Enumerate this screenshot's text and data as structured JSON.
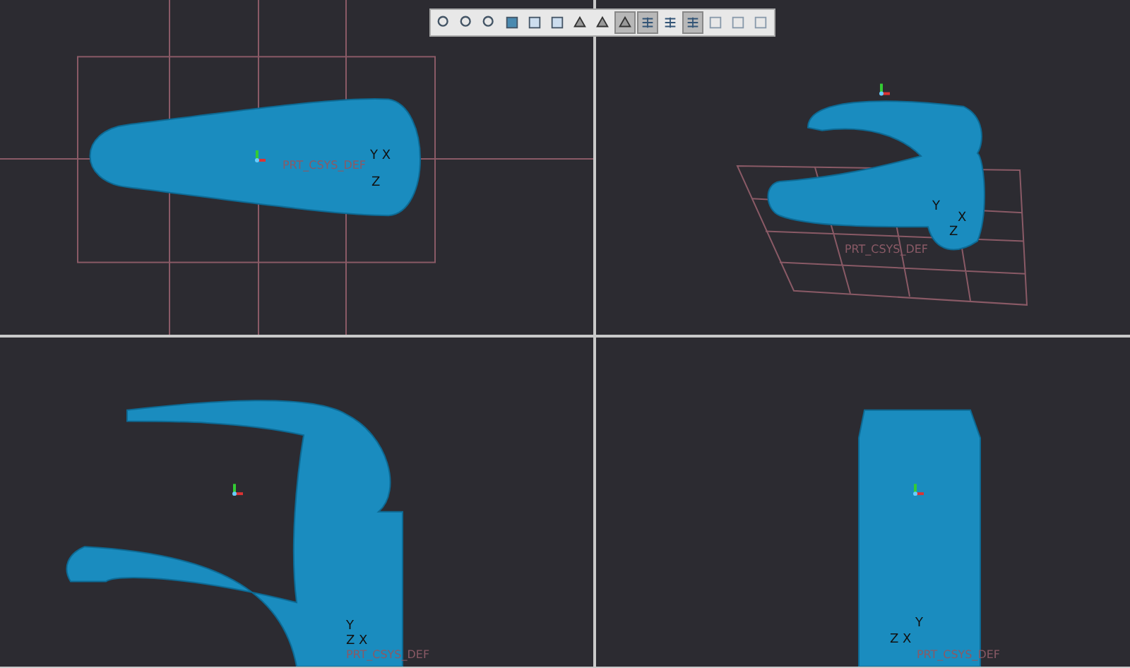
{
  "toolbar": {
    "tools": [
      {
        "selected": false
      },
      {
        "selected": false
      },
      {
        "selected": false
      },
      {
        "selected": false
      },
      {
        "selected": false
      },
      {
        "selected": false
      },
      {
        "selected": false
      },
      {
        "selected": false
      },
      {
        "selected": true
      },
      {
        "selected": true
      },
      {
        "selected": false
      },
      {
        "selected": true
      },
      {
        "selected": false
      },
      {
        "selected": false
      },
      {
        "selected": false
      }
    ]
  },
  "viewports": [
    {
      "axis_labels": [
        "Y X",
        "Z"
      ],
      "csys_label": "PRT_CSYS_DEF"
    },
    {
      "axis_labels": [
        "Y",
        "X",
        "Z"
      ],
      "csys_label": "PRT_CSYS_DEF"
    },
    {
      "axis_labels": [
        "Y",
        "Z X"
      ],
      "csys_label": "PRT_CSYS_DEF"
    },
    {
      "axis_labels": [
        "Y",
        "Z X"
      ],
      "csys_label": "PRT_CSYS_DEF"
    }
  ]
}
